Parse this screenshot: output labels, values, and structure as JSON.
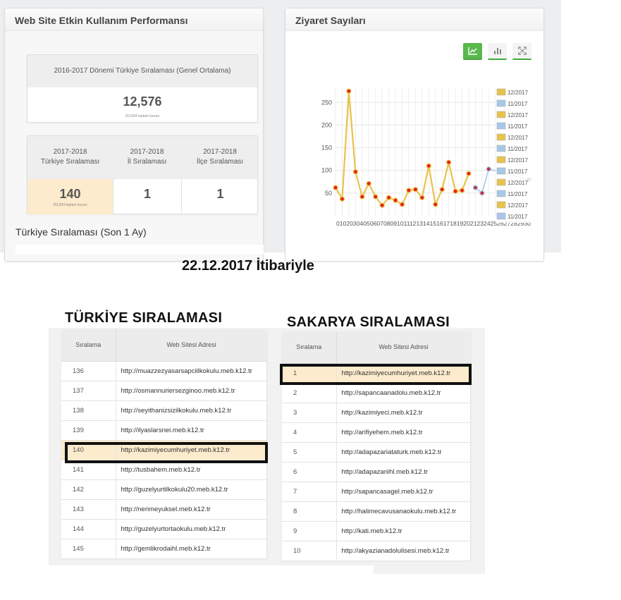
{
  "performance_panel": {
    "title": "Web Site Etkin Kullanım Performansı",
    "general_card": {
      "label": "2016-2017 Dönemi Türkiye Sıralaması (Genel Ortalama)",
      "value": "12,576",
      "note": "/53,834 toplam kurum"
    },
    "rank_cards": [
      {
        "label_line1": "2017-2018",
        "label_line2": "Türkiye Sıralaması",
        "value": "140",
        "note": "/53,834 toplam kurum"
      },
      {
        "label_line1": "2017-2018",
        "label_line2": "İl Sıralaması",
        "value": "1"
      },
      {
        "label_line1": "2017-2018",
        "label_line2": "İlçe Sıralaması",
        "value": "1"
      }
    ],
    "section_title": "Türkiye Sıralaması (Son 1 Ay)"
  },
  "visits_panel": {
    "title": "Ziyaret Sayıları",
    "toolbar": [
      "line-chart-icon",
      "bar-chart-icon",
      "fullscreen-icon"
    ]
  },
  "chart_data": {
    "type": "line",
    "yticks": [
      50,
      100,
      150,
      200,
      250
    ],
    "ylim": [
      0,
      280
    ],
    "x_axis_text": "0102030405060708091011121314151617181920212324252627282930",
    "xlim": [
      1,
      30
    ],
    "series": [
      {
        "color": "#e8c34a",
        "x": [
          1,
          2,
          3,
          4,
          5,
          6,
          7,
          8,
          9,
          10,
          11,
          12,
          13,
          14,
          15,
          16,
          17,
          18,
          19,
          20,
          21
        ],
        "y": [
          62,
          37,
          275,
          97,
          42,
          71,
          42,
          23,
          40,
          34,
          25,
          56,
          58,
          40,
          110,
          25,
          58,
          118,
          54,
          56,
          93
        ]
      },
      {
        "color": "#a8c8e8",
        "x": [
          22,
          23,
          24,
          30
        ],
        "y": [
          62,
          50,
          103,
          80
        ]
      }
    ],
    "legend": [
      "12/2017",
      "11/2017",
      "12/2017",
      "11/2017",
      "12/2017",
      "11/2017",
      "12/2017",
      "11/2017",
      "12/2017",
      "11/2017",
      "12/2017",
      "11/2017"
    ],
    "legend_colors": [
      "#e8c34a",
      "#a8c8e8"
    ]
  },
  "date_caption": "22.12.2017 İtibariyle",
  "turkiye_title": "TÜRKİYE SIRALAMASI",
  "sakarya_title": "SAKARYA SIRALAMASI",
  "table_headers": {
    "rank": "Sıralama",
    "site": "Web Sitesi Adresi"
  },
  "turkiye_rows": [
    {
      "rank": "136",
      "site": "http://muazzezyasarsapciilkokulu.meb.k12.tr"
    },
    {
      "rank": "137",
      "site": "http://osmannuriersezginoo.meb.k12.tr"
    },
    {
      "rank": "138",
      "site": "http://seyithanizsizilkokulu.meb.k12.tr"
    },
    {
      "rank": "139",
      "site": "http://ilyaslarsnei.meb.k12.tr"
    },
    {
      "rank": "140",
      "site": "http://kazimiyecumhuriyet.meb.k12.tr"
    },
    {
      "rank": "141",
      "site": "http://tusbahem.meb.k12.tr"
    },
    {
      "rank": "142",
      "site": "http://guzelyurtilkokulu20.meb.k12.tr"
    },
    {
      "rank": "143",
      "site": "http://nerimeyuksel.meb.k12.tr"
    },
    {
      "rank": "144",
      "site": "http://guzelyurtortaokulu.meb.k12.tr"
    },
    {
      "rank": "145",
      "site": "http://gemlikrodaihl.meb.k12.tr"
    }
  ],
  "sakarya_rows": [
    {
      "rank": "1",
      "site": "http://kazimiyecumhuriyet.meb.k12.tr"
    },
    {
      "rank": "2",
      "site": "http://sapancaanadolu.meb.k12.tr"
    },
    {
      "rank": "3",
      "site": "http://kazimiyeci.meb.k12.tr"
    },
    {
      "rank": "4",
      "site": "http://arifiyehem.meb.k12.tr"
    },
    {
      "rank": "5",
      "site": "http://adapazariataturk.meb.k12.tr"
    },
    {
      "rank": "6",
      "site": "http://adapazariihl.meb.k12.tr"
    },
    {
      "rank": "7",
      "site": "http://sapancasagel.meb.k12.tr"
    },
    {
      "rank": "8",
      "site": "http://halimecavusanaokulu.meb.k12.tr"
    },
    {
      "rank": "9",
      "site": "http://kati.meb.k12.tr"
    },
    {
      "rank": "10",
      "site": "http://akyazianadolulisesi.meb.k12.tr"
    }
  ]
}
